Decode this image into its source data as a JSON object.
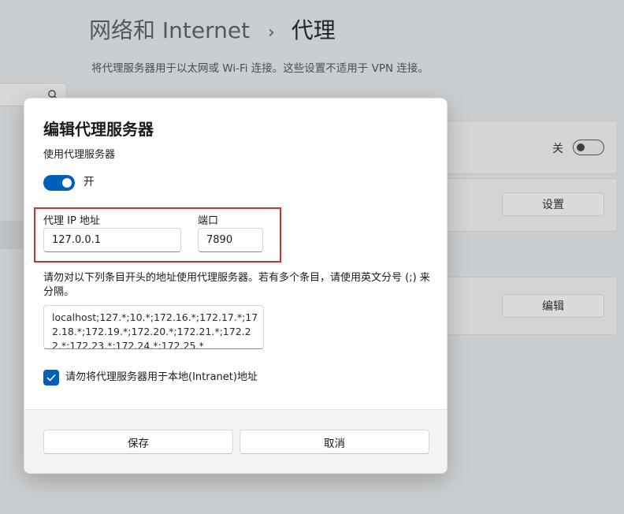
{
  "background": {
    "breadcrumb": {
      "parent": "网络和 Internet",
      "separator": "›",
      "current": "代理"
    },
    "description": "将代理服务器用于以太网或 Wi-Fi 连接。这些设置不适用于 VPN 连接。",
    "auto_detect_toggle": {
      "label": "关",
      "state": "off"
    },
    "setup_script_button": "设置",
    "manual_proxy_edit_button": "编辑"
  },
  "dialog": {
    "title": "编辑代理服务器",
    "use_proxy_label": "使用代理服务器",
    "use_proxy_state": "开",
    "use_proxy_on": true,
    "proxy_ip_label": "代理 IP 地址",
    "proxy_ip_value": "127.0.0.1",
    "port_label": "端口",
    "port_value": "7890",
    "exceptions_description": "请勿对以下列条目开头的地址使用代理服务器。若有多个条目，请使用英文分号 (;) 来分隔。",
    "exceptions_value": "localhost;127.*;10.*;172.16.*;172.17.*;172.18.*;172.19.*;172.20.*;172.21.*;172.22.*;172.23.*;172.24.*;172.25.*",
    "bypass_local_label": "请勿将代理服务器用于本地(Intranet)地址",
    "bypass_local_checked": true,
    "save_button": "保存",
    "cancel_button": "取消"
  },
  "colors": {
    "accent": "#005fb8",
    "highlight_box": "#d42b2b",
    "dim_overlay": "#cbced0"
  }
}
